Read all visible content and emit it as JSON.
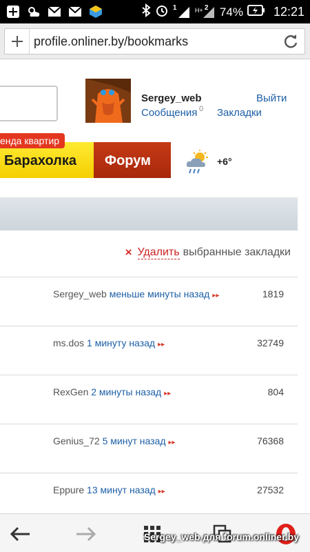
{
  "status_bar": {
    "battery_percent": "74%",
    "time": "12:21",
    "network_type": "H+",
    "sim1_label": "1",
    "sim2_label": "2"
  },
  "browser": {
    "url": "profile.onliner.by/bookmarks"
  },
  "header": {
    "username": "Sergey_web",
    "logout_label": "Выйти",
    "messages_label": "Сообщения",
    "messages_count": "0",
    "bookmarks_label": "Закладки"
  },
  "nav": {
    "rent_tag": "енда квартир",
    "baraholka_label": "Барахолка",
    "forum_label": "Форум",
    "temperature": "+6°"
  },
  "actions": {
    "delete_icon": "×",
    "delete_link": "Удалить",
    "delete_rest": "выбранные закладки"
  },
  "bookmarks": [
    {
      "author": "Sergey_web",
      "time": "меньше минуты назад",
      "count": "1819"
    },
    {
      "author": "ms.dos",
      "time": "1 минуту назад",
      "count": "32749"
    },
    {
      "author": "RexGen",
      "time": "2 минуты назад",
      "count": "804"
    },
    {
      "author": "Genius_72",
      "time": "5 минут назад",
      "count": "76368"
    },
    {
      "author": "Eppure",
      "time": "13 минут назад",
      "count": "27532"
    }
  ],
  "watermark": "Sergey_web для forum.onliner.by",
  "colors": {
    "link_blue": "#1d5fa6",
    "delete_red": "#d62b2b",
    "nav_yellow": "#ffea33",
    "nav_red": "#b8300f"
  }
}
